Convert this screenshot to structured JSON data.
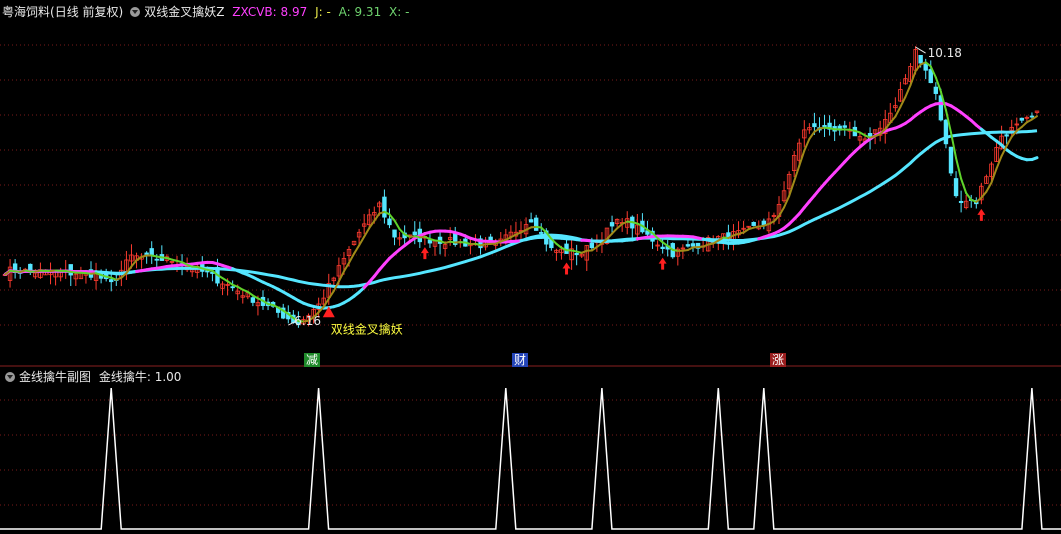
{
  "main_header": {
    "stock": "粤海饲料",
    "mode": "(日线 前复权)",
    "indicator": "双线金叉擒妖Z",
    "zx_label": "ZXCVB: 8.97",
    "j_label": "J: -",
    "a_label": "A: 9.31",
    "x_label": "X: -"
  },
  "sub_header": {
    "title": "金线擒牛副图",
    "value_label": "金线擒牛: 1.00"
  },
  "annotations": {
    "signal_text": "双线金叉擒妖",
    "high_label": "10.18",
    "low_label": "6.16"
  },
  "badges": [
    {
      "text": "减",
      "color": "#1f8a2a"
    },
    {
      "text": "财",
      "color": "#2545b8"
    },
    {
      "text": "涨",
      "color": "#9a1e1e"
    }
  ],
  "colors": {
    "up": "#ff3b2f",
    "down": "#55e6ff",
    "slow_ma": "#55e6ff",
    "fast_ma_up": "#ff40ff",
    "short_line_down": "#5fd32b",
    "short_line_up": "#a08a18",
    "grid": "#7a1a1a",
    "spike": "#ffffff"
  },
  "chart_data": [
    {
      "type": "candlestick",
      "title": "粤海饲料 (日线 前复权)",
      "price_range": [
        5.9,
        10.6
      ],
      "bars": 205,
      "close_path": [
        [
          0,
          6.95
        ],
        [
          18,
          6.9
        ],
        [
          20,
          6.78
        ],
        [
          21,
          6.75
        ],
        [
          25,
          7.15
        ],
        [
          33,
          7.1
        ],
        [
          40,
          6.9
        ],
        [
          48,
          6.58
        ],
        [
          58,
          6.18
        ],
        [
          62,
          6.45
        ],
        [
          70,
          7.5
        ],
        [
          74,
          7.9
        ],
        [
          77,
          7.45
        ],
        [
          90,
          7.35
        ],
        [
          97,
          7.3
        ],
        [
          104,
          7.7
        ],
        [
          108,
          7.25
        ],
        [
          114,
          7.2
        ],
        [
          122,
          7.7
        ],
        [
          128,
          7.4
        ],
        [
          132,
          7.2
        ],
        [
          140,
          7.4
        ],
        [
          146,
          7.5
        ],
        [
          152,
          7.7
        ],
        [
          158,
          9.0
        ],
        [
          165,
          9.0
        ],
        [
          170,
          8.8
        ],
        [
          176,
          9.3
        ],
        [
          180,
          10.15
        ],
        [
          184,
          9.5
        ],
        [
          188,
          8.0
        ],
        [
          192,
          7.95
        ],
        [
          197,
          8.9
        ],
        [
          204,
          9.2
        ]
      ],
      "series": [
        {
          "name": "ZXCVB",
          "value_last": 8.97
        },
        {
          "name": "A",
          "value_last": 9.31
        }
      ],
      "markers": [
        {
          "type": "triangle",
          "index": 64,
          "label": "双线金叉擒妖"
        },
        {
          "type": "arrow",
          "index": 83
        },
        {
          "type": "arrow",
          "index": 111
        },
        {
          "type": "arrow",
          "index": 130
        },
        {
          "type": "arrow",
          "index": 193
        }
      ],
      "high_marker": {
        "index": 180,
        "value": 10.18
      },
      "low_marker": {
        "index": 56,
        "value": 6.16
      }
    },
    {
      "type": "line",
      "title": "金线擒牛副图",
      "series": [
        {
          "name": "金线擒牛",
          "value_last": 1.0
        }
      ],
      "ylim": [
        0,
        1
      ],
      "spikes": [
        21,
        62,
        99,
        118,
        141,
        150,
        203
      ]
    }
  ]
}
